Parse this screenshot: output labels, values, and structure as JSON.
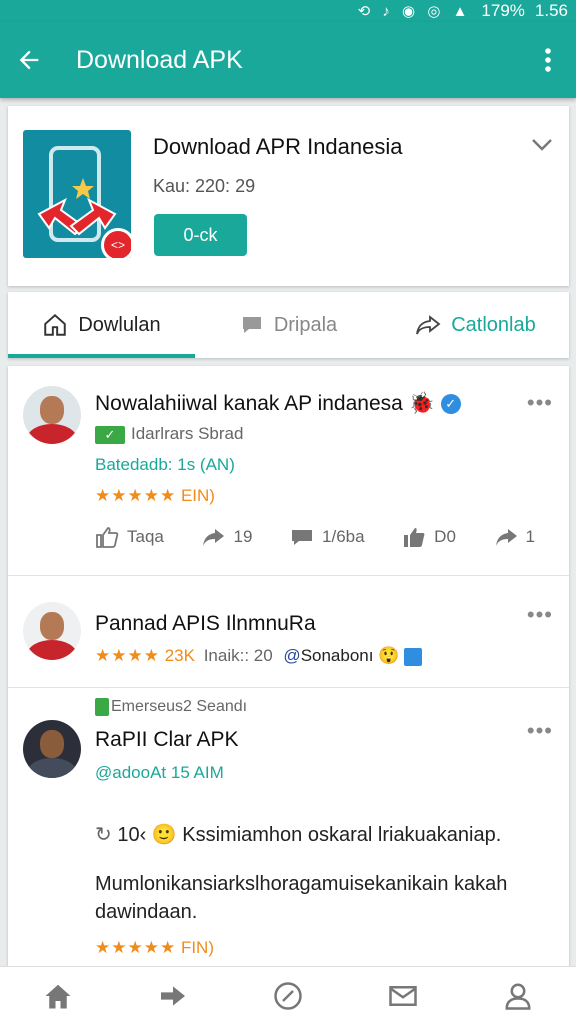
{
  "status_bar": {
    "icons": "⟲ ♪ ◉ ◎ ▲",
    "battery": "179%",
    "time": "1.56"
  },
  "app_bar": {
    "title": "Download APK",
    "back_icon": "arrow-left-icon",
    "menu_icon": "more-vertical-icon"
  },
  "app_card": {
    "name": "Download APR Indanesia",
    "meta": "Kau: 220: 29",
    "button_label": "0-ck",
    "badge": "<>"
  },
  "tabs": [
    {
      "label": "Dowlulan",
      "icon": "home-icon"
    },
    {
      "label": "Dripala",
      "icon": "comment-icon"
    },
    {
      "label": "Catlonlab",
      "icon": "share-icon"
    }
  ],
  "posts": [
    {
      "name": "Nowalahiiwal kanak AP indanesa",
      "emoji": "🐞",
      "sub": "Idarlrars Sbrad",
      "time": "Batedadb: 1s (AN)",
      "rating": "★★★★★",
      "rating_text": "EIN)",
      "actions": [
        {
          "label": "Taqa",
          "icon": "thumbs-up-icon"
        },
        {
          "label": "19",
          "icon": "share-arrow-icon"
        },
        {
          "label": "1/6ba",
          "icon": "comment-bubble-icon"
        },
        {
          "label": "D0",
          "icon": "thumbs-up-icon"
        },
        {
          "label": "1",
          "icon": "share-arrow-icon"
        }
      ]
    },
    {
      "name": "Pannad APIS IlnmnuRa",
      "rating": "★★★★",
      "rating_count": "23K",
      "meta": "Inaik:: 20",
      "tag": "Sonabonı",
      "emoji": "😲"
    },
    {
      "label": "Emerseus2 Seandı",
      "name": "RaPII Clar APK",
      "handle": "@adooAt 15 AIM",
      "count": "10‹",
      "body1": "Kssimiamhon oskaral lriakuakaniap.",
      "body2a": "Mumlonikansiarkslhoragamuisekanikain kakah",
      "body2b": "dawindaan.",
      "rating": "★★★★★",
      "rating_text": "FIN)"
    }
  ],
  "bottom_nav": [
    "home-icon",
    "forward-icon",
    "compass-icon",
    "mail-icon",
    "profile-icon"
  ]
}
